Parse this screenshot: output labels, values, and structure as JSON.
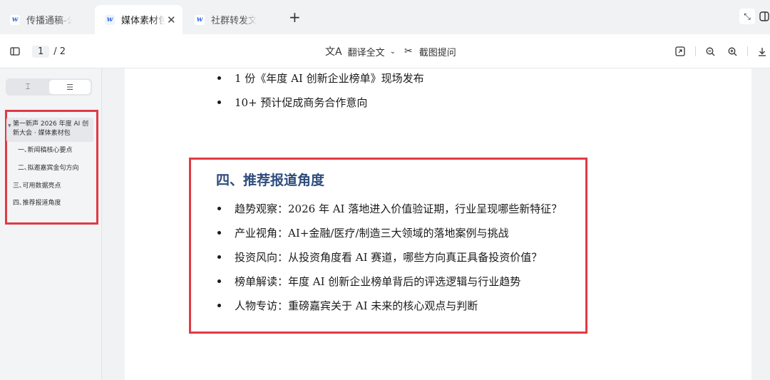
{
  "tabs": [
    {
      "label": "传播通稿-公"
    },
    {
      "label": "媒体素材包"
    },
    {
      "label": "社群转发文"
    }
  ],
  "toolbar": {
    "page_current": "1",
    "page_total": "/ 2",
    "translate_label": "翻译全文",
    "screenshot_label": "截图提问"
  },
  "sidebar": {
    "outline": [
      {
        "label": "第一新声 2026 年度 AI 创新大会 · 媒体素材包"
      },
      {
        "label": "一､新闻稿核心要点"
      },
      {
        "label": "二､拟邀嘉宾金句方向"
      },
      {
        "label": "三､可用数据亮点"
      },
      {
        "label": "四､推荐报道角度"
      }
    ]
  },
  "document": {
    "top_bullets": [
      "1 份《年度 AI 创新企业榜单》现场发布",
      "10+ 预计促成商务合作意向"
    ],
    "section_title": "四、推荐报道角度",
    "section_bullets": [
      {
        "head": "趋势观察：",
        "text": "2026 年 AI 落地进入价值验证期，行业呈现哪些新特征？"
      },
      {
        "head": "产业视角：",
        "text": "AI+金融/医疗/制造三大领域的落地案例与挑战"
      },
      {
        "head": "投资风向：",
        "text": "从投资角度看 AI 赛道，哪些方向真正具备投资价值？"
      },
      {
        "head": "榜单解读：",
        "text": "年度 AI 创新企业榜单背后的评选逻辑与行业趋势"
      },
      {
        "head": "人物专访：",
        "text": "重磅嘉宾关于 AI 未来的核心观点与判断"
      }
    ]
  },
  "colors": {
    "highlight_border": "#e03a45",
    "section_title": "#2e4d7d",
    "tab_icon": "#3b6fe0"
  }
}
